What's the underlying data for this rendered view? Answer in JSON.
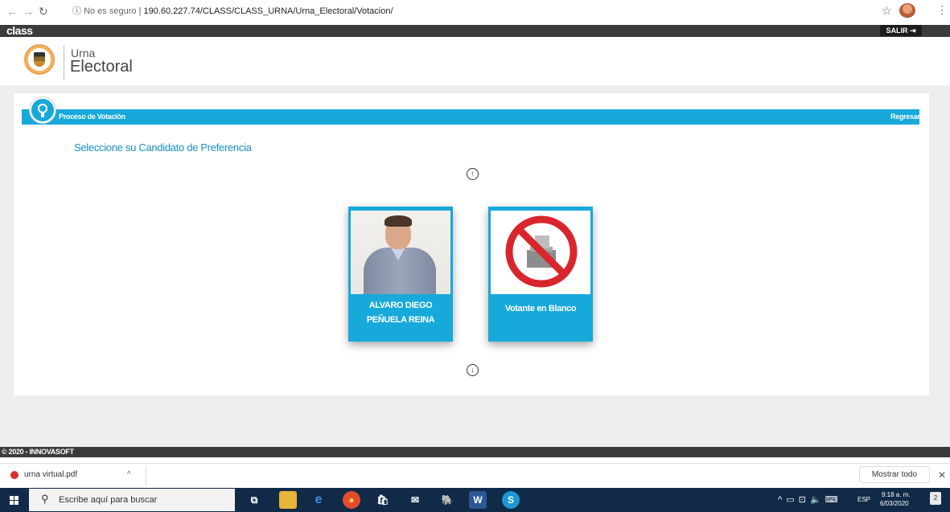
{
  "browser": {
    "security_label": "No es seguro",
    "url": "190.60.227.74/CLASS/CLASS_URNA/Urna_Electoral/Votacion/"
  },
  "app": {
    "brand": "class",
    "logout_label": "SALIR",
    "name_line1": "Urna",
    "name_line2": "Electoral"
  },
  "section": {
    "title": "Proceso de Votación",
    "back_label": "Regresar"
  },
  "prompt": "Seleccione su Candidato de Preferencia",
  "candidates": [
    {
      "name": "ALVARO DIEGO PEÑUELA REINA"
    },
    {
      "name": "Votante en Blanco"
    }
  ],
  "footer": {
    "copyright": "© 2020 - INNOVASOFT"
  },
  "downloads": {
    "file_name": "urna virtual.pdf",
    "show_all_label": "Mostrar todo"
  },
  "taskbar": {
    "search_placeholder": "Escribe aquí para buscar",
    "language": "ESP",
    "time": "9:18 a. m.",
    "date": "6/03/2020",
    "notification_count": "2"
  },
  "colors": {
    "accent": "#17a9d9",
    "header_dark": "#3b3b3b",
    "taskbar": "#102a48",
    "prompt_text": "#1a8fc1"
  }
}
